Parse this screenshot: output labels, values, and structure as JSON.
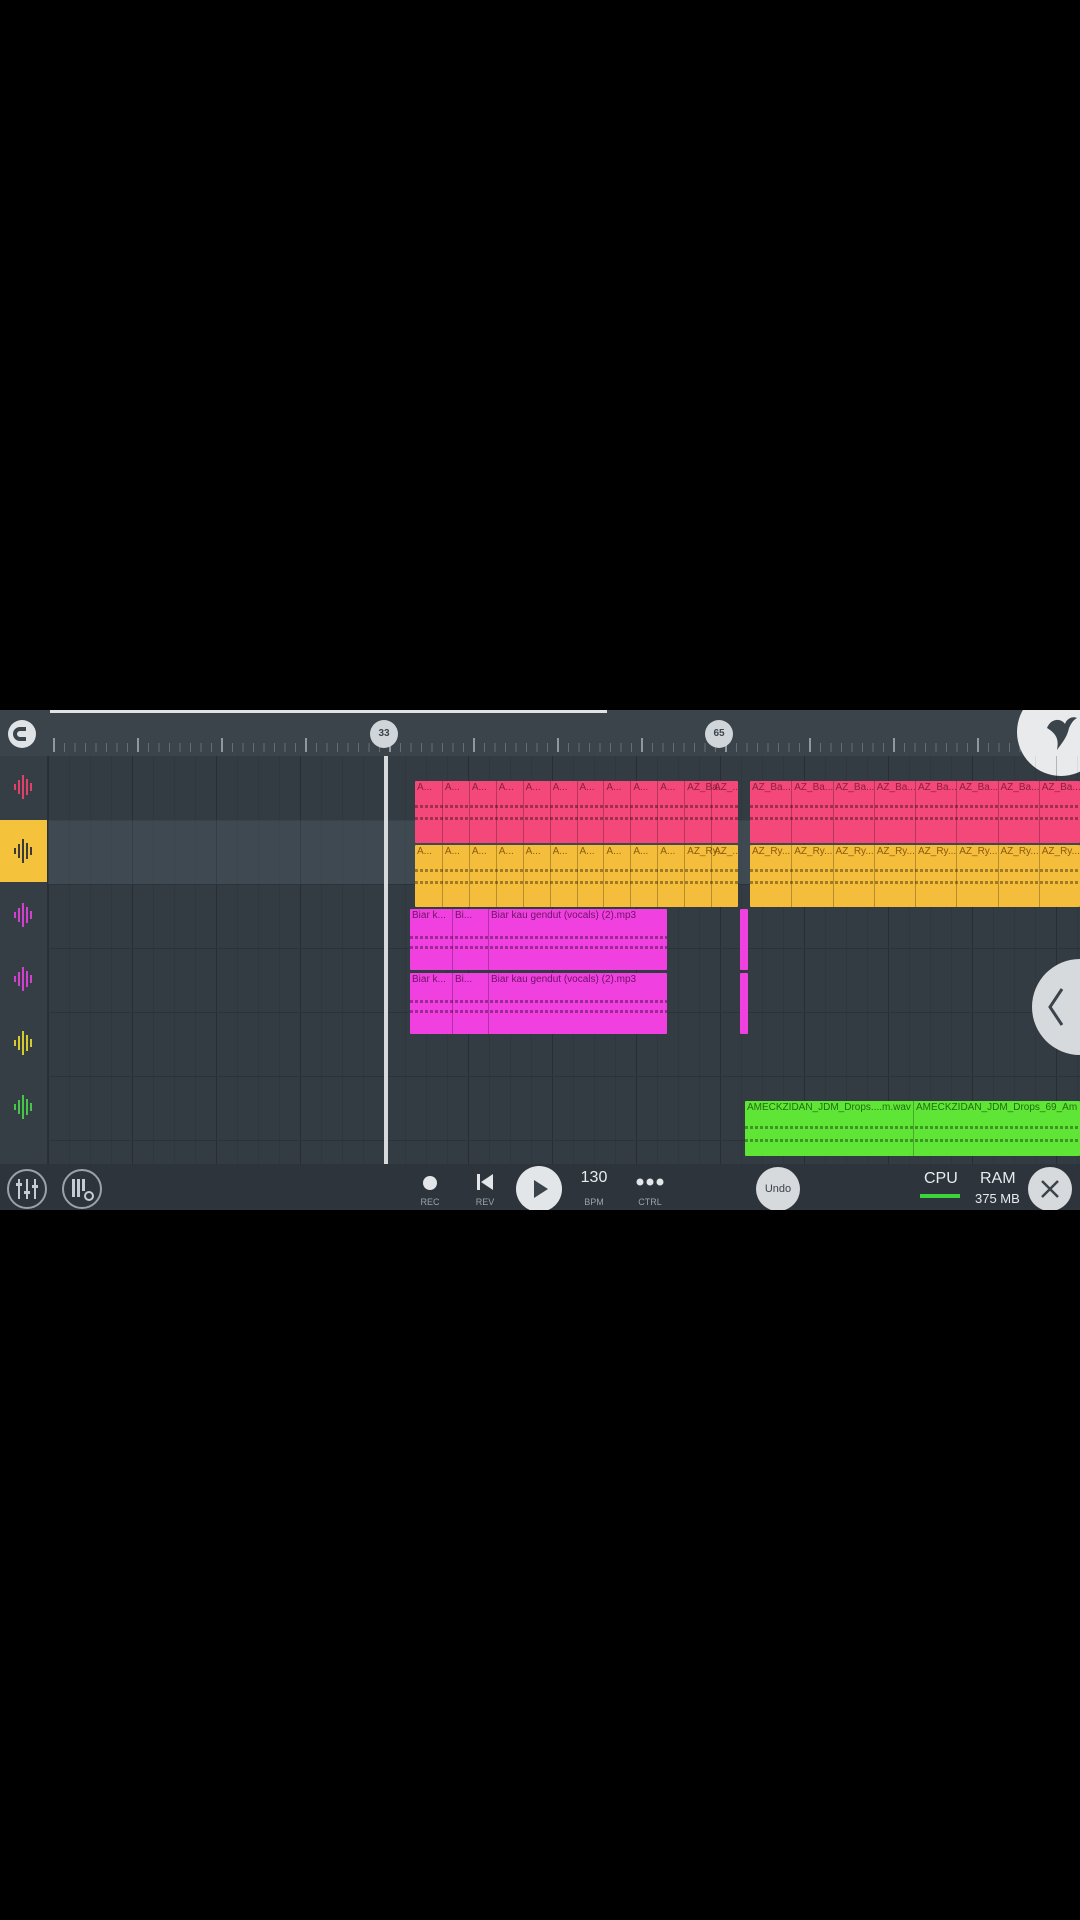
{
  "timeline": {
    "markers": [
      {
        "label": "33"
      },
      {
        "label": "65"
      }
    ]
  },
  "tracks": [
    {
      "icon": "waveform-icon",
      "color": "#e0406a",
      "selected": false
    },
    {
      "icon": "waveform-icon",
      "color": "#3a3a3a",
      "selected": true
    },
    {
      "icon": "waveform-icon",
      "color": "#d33fd1",
      "selected": false
    },
    {
      "icon": "waveform-icon",
      "color": "#d33fd1",
      "selected": false
    },
    {
      "icon": "waveform-icon",
      "color": "#d5cb2f",
      "selected": false
    },
    {
      "icon": "waveform-icon",
      "color": "#46c546",
      "selected": false
    }
  ],
  "clips": {
    "track1_labels": [
      "A...",
      "A...",
      "A...",
      "A...",
      "A...",
      "A...",
      "A...",
      "A...",
      "A...",
      "A...",
      "AZ_Ba...",
      "AZ_...",
      "AZ_Ba...",
      "AZ_Ba...",
      "AZ_Ba...",
      "AZ_Ba...",
      "AZ_Ba...",
      "AZ_Ba...",
      "AZ_Ba...",
      "AZ_Ba..."
    ],
    "track2_labels": [
      "A...",
      "A...",
      "A...",
      "A...",
      "A...",
      "A...",
      "A...",
      "A...",
      "A...",
      "A...",
      "AZ_Ry...",
      "AZ_...",
      "AZ_Ry...",
      "AZ_Ry...",
      "AZ_Ry...",
      "AZ_Ry...",
      "AZ_Ry...",
      "AZ_Ry...",
      "AZ_Ry...",
      "AZ_Ry..."
    ],
    "vocal": [
      "Biar k...",
      "Bi...",
      "Biar kau gendut (vocals) (2).mp3"
    ],
    "drops": [
      "AMECKZIDAN_JDM_Drops....m.wav",
      "AMECKZIDAN_JDM_Drops_69_Am"
    ]
  },
  "colors": {
    "pink_clip": "#f5487a",
    "yellow_clip": "#f5bd3c",
    "magenta_clip": "#f040e0",
    "green_clip": "#5fe536"
  },
  "toolbar": {
    "rec": "REC",
    "rev": "REV",
    "bpm_value": "130",
    "bpm_label": "BPM",
    "ctrl": "CTRL",
    "undo": "Undo",
    "cpu": "CPU",
    "ram": "RAM",
    "ram_value": "375 MB"
  }
}
